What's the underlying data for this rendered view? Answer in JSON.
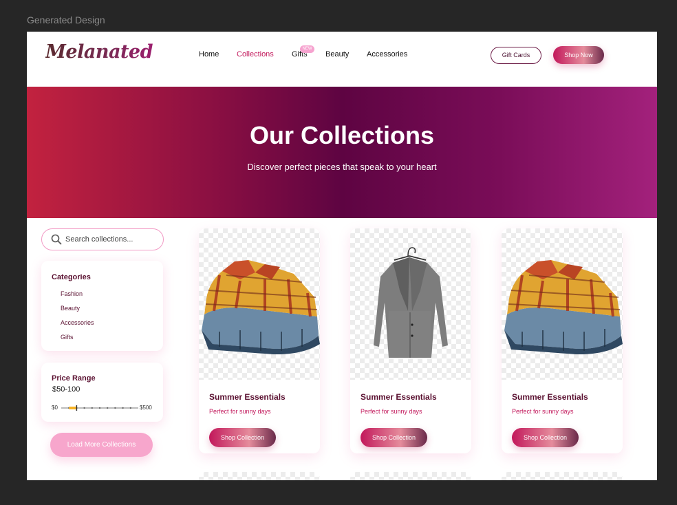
{
  "frame": {
    "label": "Generated Design"
  },
  "header": {
    "logo": "Melanated",
    "nav": [
      {
        "label": "Home",
        "active": false
      },
      {
        "label": "Collections",
        "active": true
      },
      {
        "label": "Gifts",
        "active": false
      },
      {
        "label": "Beauty",
        "active": false
      },
      {
        "label": "Accessories",
        "active": false
      }
    ],
    "gifts_badge": "NEW",
    "gift_cards_label": "Gift Cards",
    "shop_now_label": "Shop Now"
  },
  "hero": {
    "title": "Our Collections",
    "subtitle": "Discover perfect pieces that speak to your heart"
  },
  "sidebar": {
    "search_placeholder": "Search collections...",
    "categories_title": "Categories",
    "categories": [
      "Fashion",
      "Beauty",
      "Accessories",
      "Gifts"
    ],
    "price_title": "Price Range",
    "price_value": "$50-100",
    "range_min": "$0",
    "range_max": "$500",
    "range_fraction": [
      0.1,
      0.2
    ],
    "load_more_label": "Load More Collections"
  },
  "products": [
    {
      "image": "plaid-shirts-stack",
      "title": "Summer Essentials",
      "subtitle": "Perfect for sunny days",
      "button": "Shop Collection"
    },
    {
      "image": "grey-coat-on-hanger",
      "title": "Summer Essentials",
      "subtitle": "Perfect for sunny days",
      "button": "Shop Collection"
    },
    {
      "image": "plaid-shirts-stack",
      "title": "Summer Essentials",
      "subtitle": "Perfect for sunny days",
      "button": "Shop Collection"
    }
  ],
  "colors": {
    "accent": "#c2185b",
    "deep_plum": "#5e0442",
    "soft_pink": "#f7a6cc",
    "text_plum": "#5a1030"
  }
}
